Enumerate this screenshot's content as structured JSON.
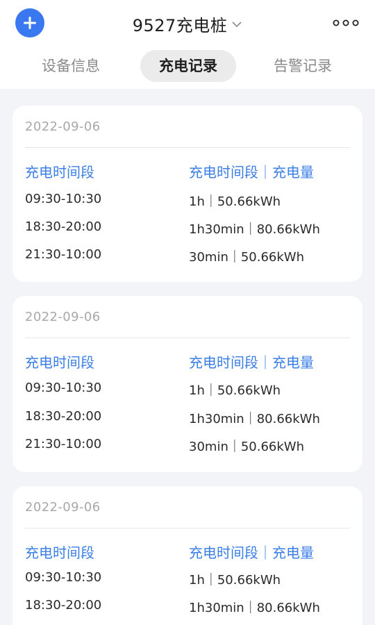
{
  "header": {
    "title": "9527充电桩",
    "add_icon": "plus-icon",
    "more_icon": "more-dots-icon",
    "accent": "#3a78f2"
  },
  "tabs": [
    {
      "label": "设备信息",
      "active": false
    },
    {
      "label": "充电记录",
      "active": true
    },
    {
      "label": "告警记录",
      "active": false
    }
  ],
  "records": [
    {
      "date": "2022-09-06",
      "col1_header": "充电时间段",
      "col2_header": "充电时间段｜充电量",
      "rows": [
        {
          "period": "09:30-10:30",
          "summary": "1h｜50.66kWh"
        },
        {
          "period": "18:30-20:00",
          "summary": "1h30min｜80.66kWh"
        },
        {
          "period": "21:30-10:00",
          "summary": "30min｜50.66kWh"
        }
      ]
    },
    {
      "date": "2022-09-06",
      "col1_header": "充电时间段",
      "col2_header": "充电时间段｜充电量",
      "rows": [
        {
          "period": "09:30-10:30",
          "summary": "1h｜50.66kWh"
        },
        {
          "period": "18:30-20:00",
          "summary": "1h30min｜80.66kWh"
        },
        {
          "period": "21:30-10:00",
          "summary": "30min｜50.66kWh"
        }
      ]
    },
    {
      "date": "2022-09-06",
      "col1_header": "充电时间段",
      "col2_header": "充电时间段｜充电量",
      "rows": [
        {
          "period": "09:30-10:30",
          "summary": "1h｜50.66kWh"
        },
        {
          "period": "18:30-20:00",
          "summary": "1h30min｜80.66kWh"
        }
      ]
    }
  ]
}
